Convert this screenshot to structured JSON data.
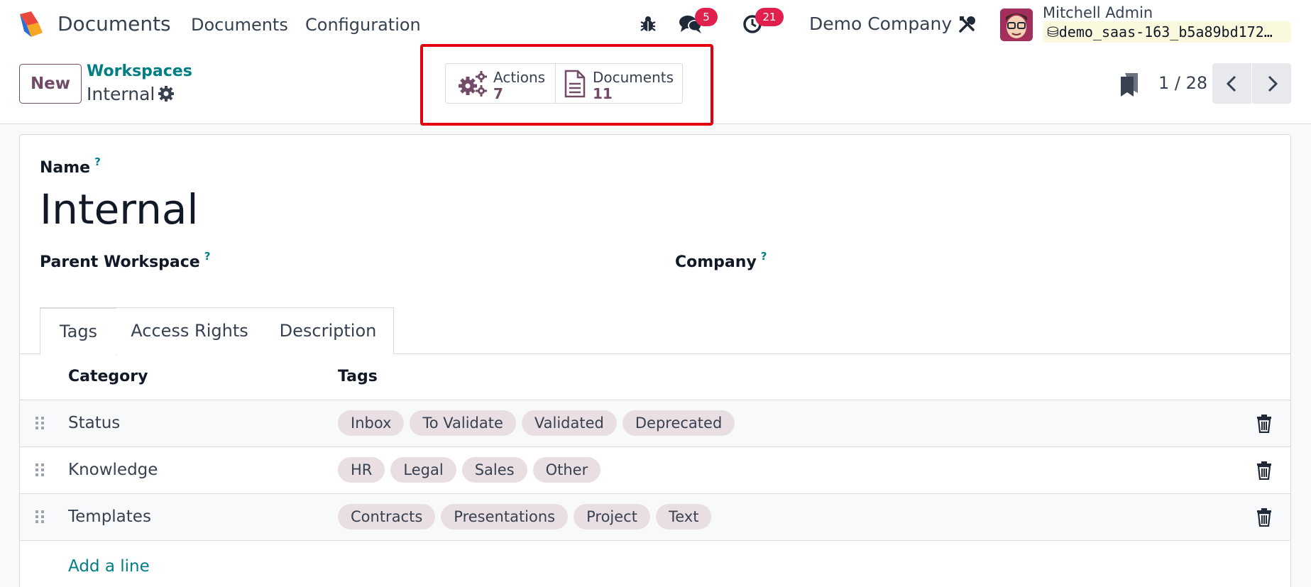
{
  "navbar": {
    "app_name": "Documents",
    "menu": [
      "Documents",
      "Configuration"
    ],
    "messages_count": "5",
    "activities_count": "21",
    "company": "Demo Company",
    "user_name": "Mitchell Admin",
    "database": "demo_saas-163_b5a89bd172…"
  },
  "control_panel": {
    "new_label": "New",
    "breadcrumb_parent": "Workspaces",
    "breadcrumb_current": "Internal",
    "smart_buttons": [
      {
        "label": "Actions",
        "count": "7"
      },
      {
        "label": "Documents",
        "count": "11"
      }
    ],
    "pager": "1 / 28"
  },
  "form": {
    "name_label": "Name",
    "help_mark": "?",
    "name_value": "Internal",
    "parent_label": "Parent Workspace",
    "company_label": "Company",
    "tabs": [
      "Tags",
      "Access Rights",
      "Description"
    ],
    "active_tab": "Tags",
    "columns": [
      "Category",
      "Tags"
    ],
    "rows": [
      {
        "category": "Status",
        "tags": [
          "Inbox",
          "To Validate",
          "Validated",
          "Deprecated"
        ]
      },
      {
        "category": "Knowledge",
        "tags": [
          "HR",
          "Legal",
          "Sales",
          "Other"
        ]
      },
      {
        "category": "Templates",
        "tags": [
          "Contracts",
          "Presentations",
          "Project",
          "Text"
        ]
      }
    ],
    "add_line": "Add a line"
  },
  "colors": {
    "brand": "#714b67",
    "link": "#017e84",
    "badge": "#e0214e",
    "highlight": "#e3000f",
    "tag_bg": "#e9dfe3"
  },
  "icons": [
    "app-logo",
    "bug-icon",
    "chat-icon",
    "clock-icon",
    "tools-icon",
    "database-icon",
    "gear-icon",
    "gears-icon",
    "document-icon",
    "bookmark-icon",
    "chevron-left-icon",
    "chevron-right-icon",
    "drag-handle-icon",
    "trash-icon"
  ]
}
